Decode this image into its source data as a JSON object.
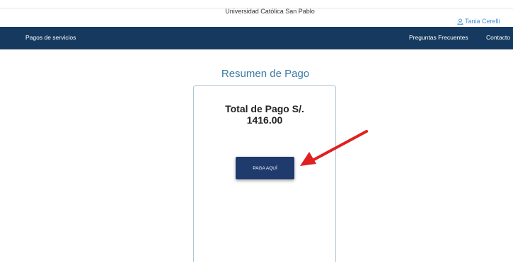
{
  "header": {
    "university": "Universidad Católica San Pablo",
    "user_name": "Tania Cerelli",
    "user_icon": "user-icon"
  },
  "nav": {
    "services": "Pagos de servicios",
    "faq": "Preguntas Frecuentes",
    "contact": "Contacto"
  },
  "summary": {
    "title": "Resumen de Pago",
    "total_label": "Total de Pago S/.",
    "total_amount": "1416.00",
    "pay_button_label": "PAGA AQUÍ"
  },
  "colors": {
    "navbar": "#163a5f",
    "title": "#3a7ca5",
    "button": "#1f3a6d",
    "arrow": "#e02020"
  }
}
